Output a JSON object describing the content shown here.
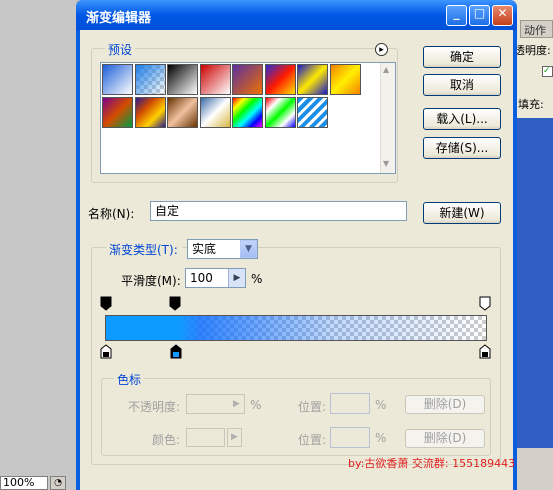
{
  "dialog": {
    "title": "渐变编辑器",
    "buttons": {
      "minimize": "_",
      "maximize": "□",
      "close": "✕"
    },
    "presets_label": "预设",
    "presets_menu_icon": "▸",
    "swatch_colors": [
      [
        "linear-gradient(135deg,#1e5fd8,#fff)",
        "checker-blue",
        "linear-gradient(135deg,#000,#fff)",
        "linear-gradient(135deg,#c00,#fff)",
        "linear-gradient(135deg,#5a2f9e,#f07000)",
        "linear-gradient(135deg,#2a2bd0,#ff1a00,#ffe000)",
        "linear-gradient(135deg,#1818c8,#ffe900,#1818c8)",
        "linear-gradient(135deg,#f58200,#fff000,#f58200)"
      ],
      [
        "linear-gradient(135deg,#7a0088,#d44d00,#009b43)",
        "linear-gradient(135deg,#2c1a90,#d14b00,#ffd000,#2c1a90)",
        "linear-gradient(135deg,#663300,#f0c0a0,#663300)",
        "linear-gradient(135deg,#3a6aa8,#fff,#d8b440)",
        "linear-gradient(135deg,#f00,#ff0,#0f0,#0ff,#00f,#f0f)",
        "linear-gradient(135deg,#f00,#fff,#0f0,#fff,#00f)",
        "repeating-linear-gradient(135deg,#1b8ee8 0 4px,#fff 4px 7px)",
        null
      ]
    ],
    "ok": "确定",
    "cancel": "取消",
    "load": "载入(L)...",
    "save": "存储(S)...",
    "name_label": "名称(N):",
    "name_value": "自定",
    "new": "新建(W)",
    "gradient_type_label": "渐变类型(T):",
    "gradient_type_value": "实底",
    "smoothness_label": "平滑度(M):",
    "smoothness_value": "100",
    "smoothness_unit": "%",
    "stops_label": "色标",
    "opacity_label": "不透明度:",
    "opacity_unit": "%",
    "position_label": "位置:",
    "position_unit": "%",
    "delete_label": "删除(D)",
    "color_label": "颜色:",
    "position_label2": "位置:",
    "position_unit2": "%",
    "delete_label2": "删除(D)",
    "watermark": "by:古欲香萧 交流群: 155189443"
  },
  "background": {
    "tab_label": "动作",
    "opacity_label": "透明度:",
    "fill_label": "填充:",
    "zoom": "100%"
  },
  "colors": {
    "accent": "#0046d5",
    "gradient_start": "#0e9bff",
    "watermark": "#e0201f"
  }
}
